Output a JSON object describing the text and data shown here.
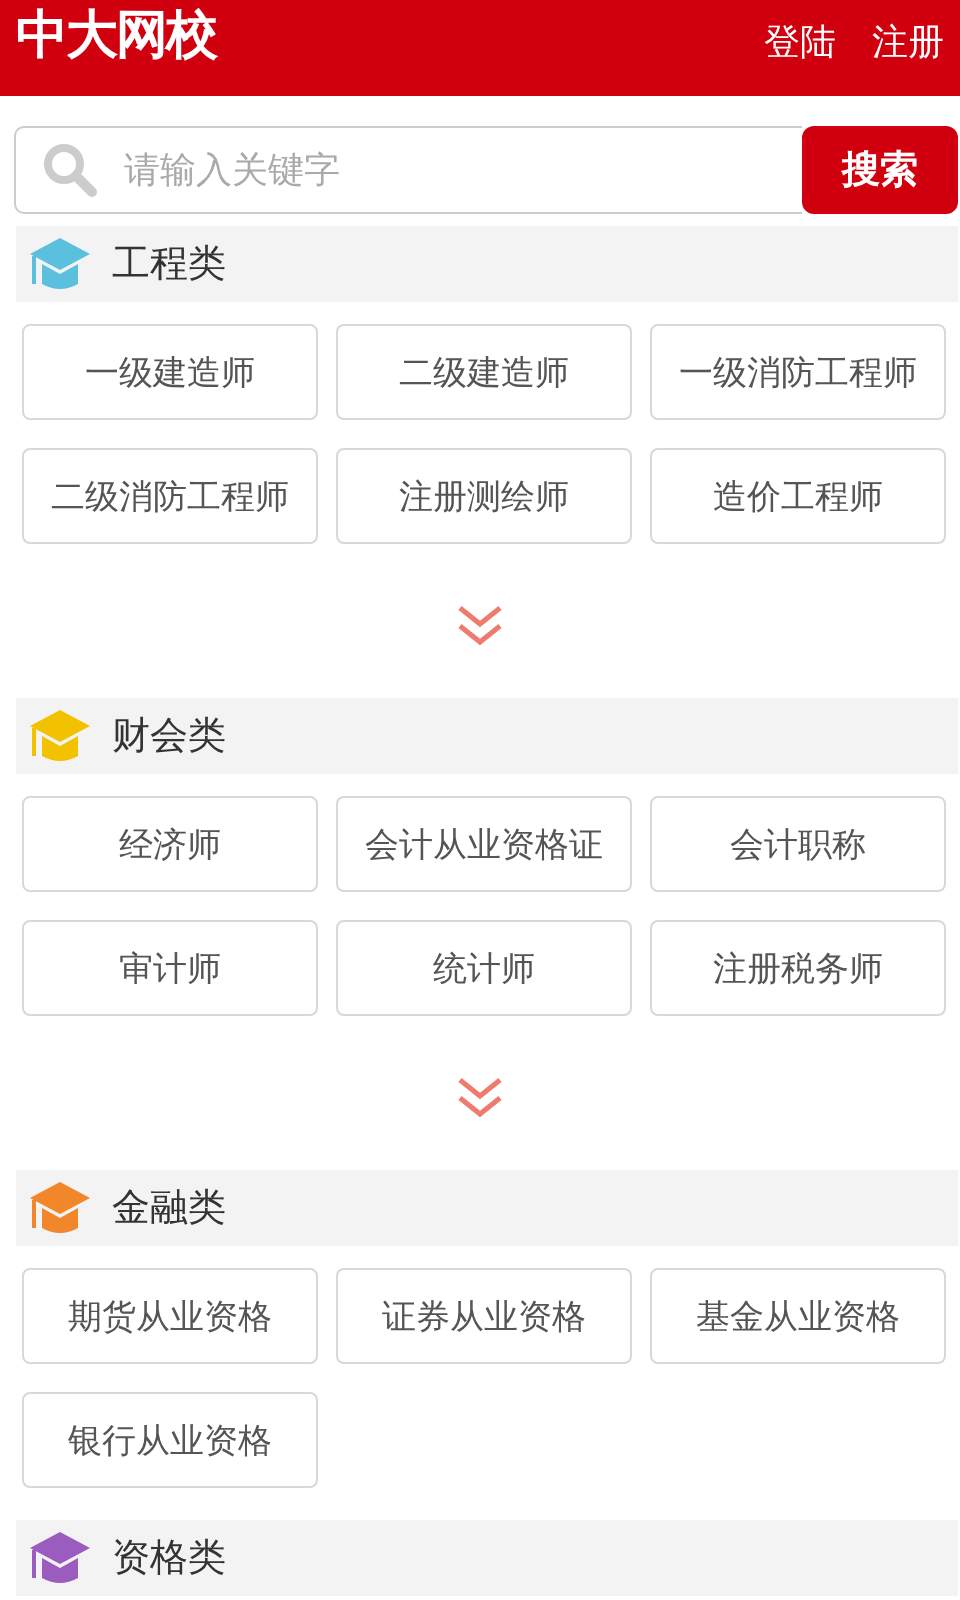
{
  "header": {
    "logo": "中大网校",
    "links": [
      "登陆",
      "注册"
    ]
  },
  "search": {
    "placeholder": "请输入关键字",
    "button": "搜索"
  },
  "categories": [
    {
      "title": "工程类",
      "color": "#5bc0de",
      "more": true,
      "items": [
        "一级建造师",
        "二级建造师",
        "一级消防工程师",
        "二级消防工程师",
        "注册测绘师",
        "造价工程师"
      ]
    },
    {
      "title": "财会类",
      "color": "#f2c200",
      "more": true,
      "items": [
        "经济师",
        "会计从业资格证",
        "会计职称",
        "审计师",
        "统计师",
        "注册税务师"
      ]
    },
    {
      "title": "金融类",
      "color": "#f2862a",
      "more": false,
      "items": [
        "期货从业资格",
        "证券从业资格",
        "基金从业资格",
        "银行从业资格"
      ]
    },
    {
      "title": "资格类",
      "color": "#9b5cc0",
      "more": false
    }
  ]
}
